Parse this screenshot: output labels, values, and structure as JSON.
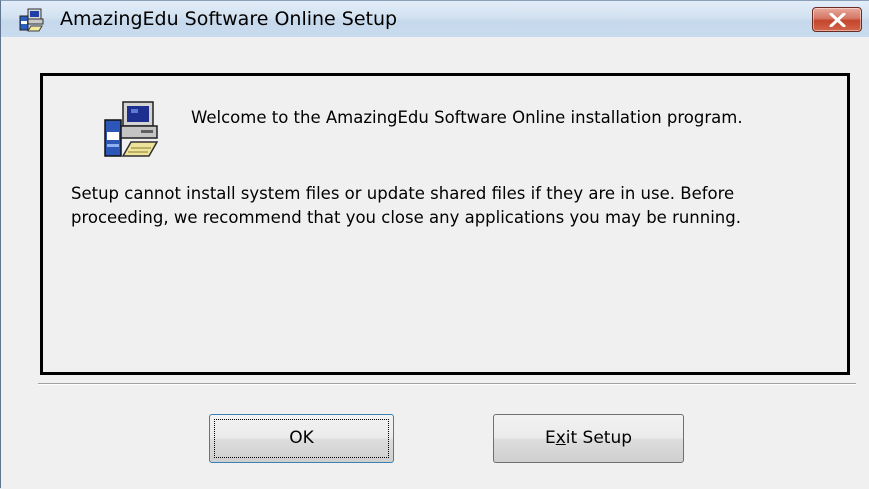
{
  "window": {
    "title": "AmazingEdu Software Online Setup",
    "close_tooltip_icon": "close-icon"
  },
  "content": {
    "welcome": "Welcome to the AmazingEdu Software Online installation program.",
    "warning": "Setup cannot install system files or update shared files if they are in use. Before proceeding, we recommend that you close any applications you may be running."
  },
  "buttons": {
    "ok_label": "OK",
    "exit_prefix": "E",
    "exit_mnemonic": "x",
    "exit_suffix": "it Setup"
  },
  "colors": {
    "titlebar": "#cfdff0",
    "close_button": "#c94f36",
    "panel_border": "#000000",
    "dialog_bg": "#f0f0f0"
  }
}
